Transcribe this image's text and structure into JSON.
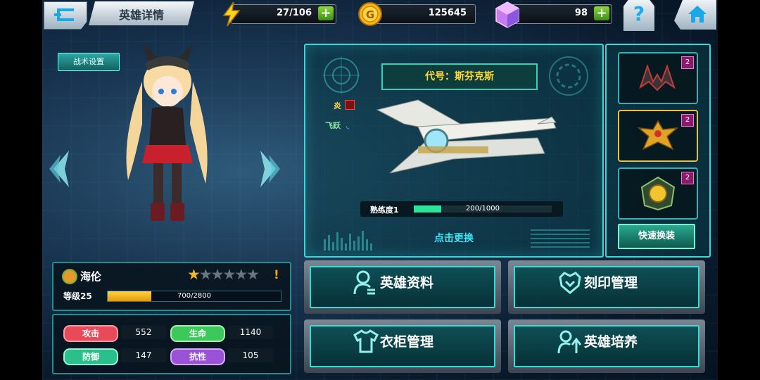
{
  "header": {
    "title": "英雄详情",
    "energy": "27/106",
    "gold": "125645",
    "gems": "98"
  },
  "left": {
    "tactics_button": "战术设置",
    "hero_name": "海伦",
    "stars": {
      "filled": 1,
      "total": 6
    },
    "alert": "!",
    "level_label": "等级25",
    "exp_text": "700/2800",
    "exp_fraction": 0.25,
    "stats": {
      "attack_label": "攻击",
      "attack": "552",
      "hp_label": "生命",
      "hp": "1140",
      "defense_label": "防御",
      "defense": "147",
      "resist_label": "抗性",
      "resist": "105"
    }
  },
  "weapon": {
    "code_name": "代号：斯芬克斯",
    "element_label": "炎",
    "skill_label": "飞跃",
    "proficiency_label": "熟练度1",
    "proficiency_text": "200/1000",
    "proficiency_fraction": 0.2,
    "change_link": "点击更换"
  },
  "equipment": {
    "slots": [
      {
        "level": "2"
      },
      {
        "level": "2"
      },
      {
        "level": "2"
      }
    ],
    "quick_equip": "快速换装"
  },
  "menu": {
    "hero_profile": "英雄资料",
    "imprint": "刻印管理",
    "wardrobe": "衣柜管理",
    "training": "英雄培养"
  },
  "colors": {
    "accent": "#47d3d3",
    "gold": "#ffda3a",
    "attack": "#e84a5a",
    "hp": "#3cc85a",
    "defense": "#2bbf8c",
    "resist": "#9a52d6"
  }
}
